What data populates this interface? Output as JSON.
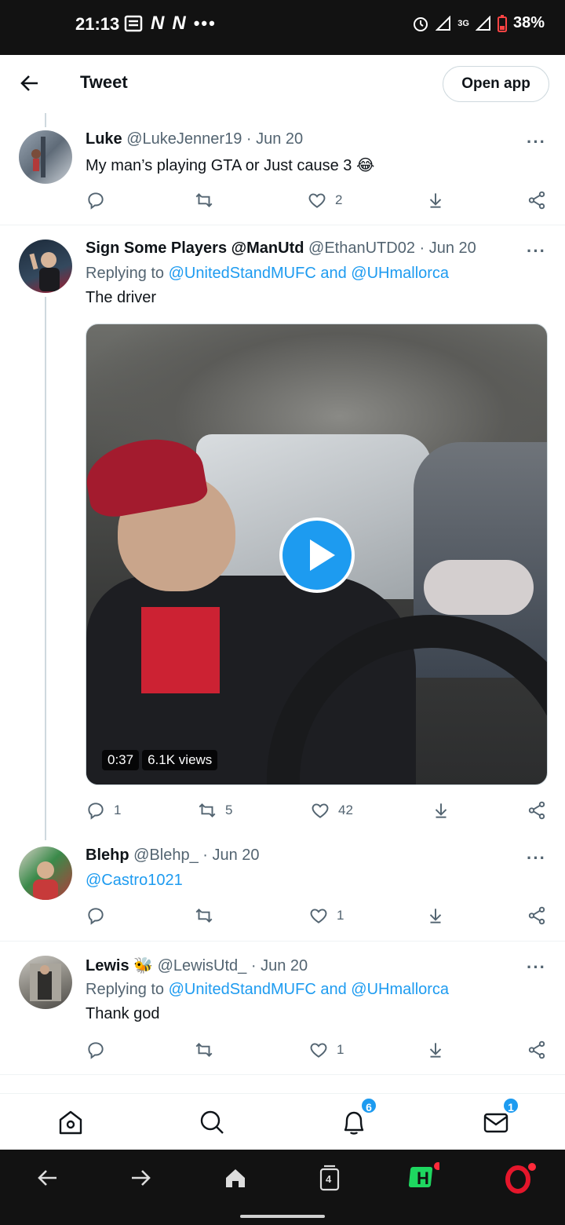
{
  "status_bar": {
    "time": "21:13",
    "left_icons": [
      "news-icon",
      "n-icon",
      "n-icon",
      "more-dots-icon"
    ],
    "network": "3G",
    "battery": "38%"
  },
  "header": {
    "title": "Tweet",
    "open_app_label": "Open app"
  },
  "tweets": [
    {
      "name": "Luke",
      "handle": "@LukeJenner19",
      "sep": "·",
      "date": "Jun 20",
      "text": "My man’s playing GTA or Just cause 3",
      "emoji": "😂",
      "replies": "",
      "retweets": "",
      "likes": "2"
    },
    {
      "name": "Sign Some Players @ManUtd",
      "handle": "@EthanUTD02",
      "sep": "·",
      "date": "Jun 20",
      "replying_prefix": "Replying to",
      "replying_to_1": "@UnitedStandMUFC",
      "replying_and": "and",
      "replying_to_2": "@UHmallorca",
      "text": "The driver",
      "video_duration": "0:37",
      "video_views": "6.1K views",
      "replies": "1",
      "retweets": "5",
      "likes": "42"
    },
    {
      "name": "Blehp",
      "handle": "@Blehp_",
      "sep": "·",
      "date": "Jun 20",
      "text": "@Castro1021",
      "replies": "",
      "retweets": "",
      "likes": "1"
    },
    {
      "name": "Lewis",
      "name_emoji": "🐝",
      "handle": "@LewisUtd_",
      "sep": "·",
      "date": "Jun 20",
      "replying_prefix": "Replying to",
      "replying_to_1": "@UnitedStandMUFC",
      "replying_and": "and",
      "replying_to_2": "@UHmallorca",
      "text": "Thank god",
      "replies": "",
      "retweets": "",
      "likes": "1"
    }
  ],
  "bottom_nav": {
    "notifications_badge": "6",
    "messages_badge": "1"
  },
  "browser_bar": {
    "tabs_count": "4"
  },
  "colors": {
    "accent": "#1d9bf0",
    "text": "#0f1419",
    "secondary": "#536471"
  }
}
